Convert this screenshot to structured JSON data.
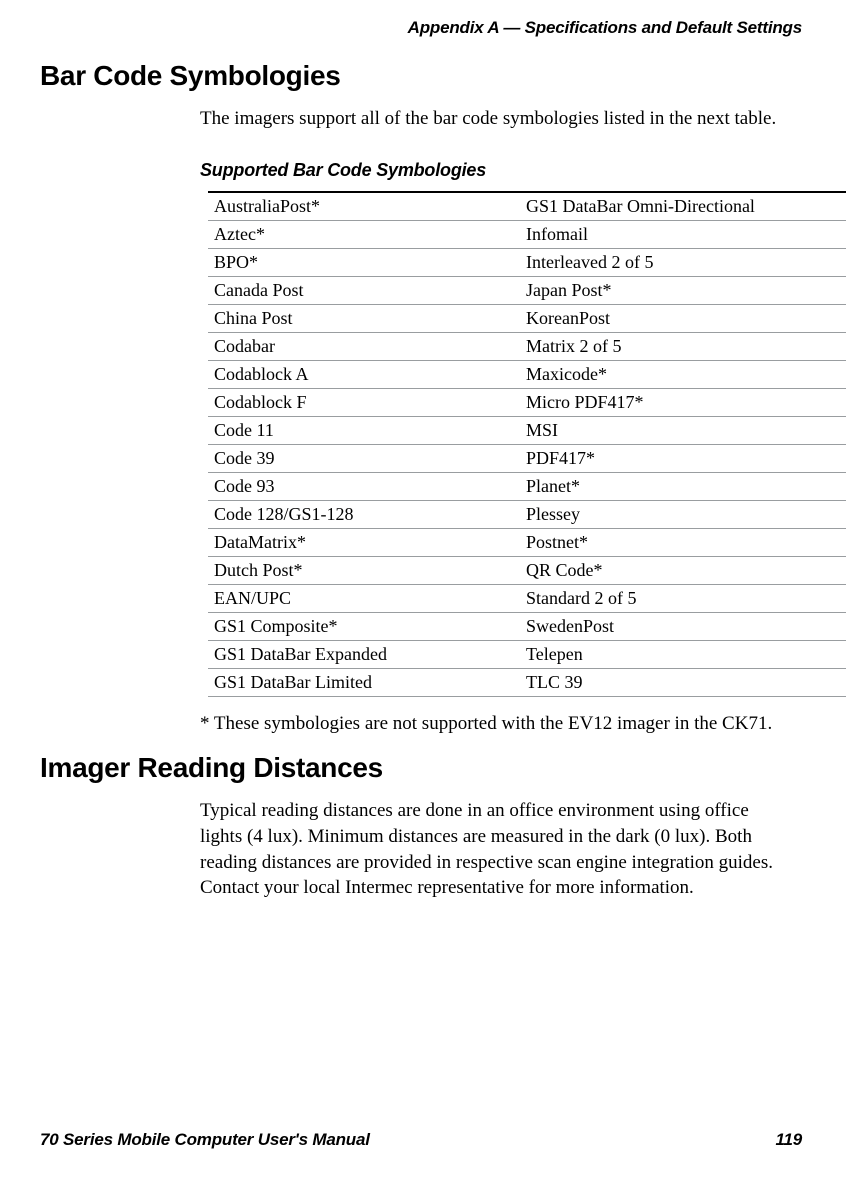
{
  "running_header": "Appendix A — Specifications and Default Settings",
  "section1_heading": "Bar Code Symbologies",
  "section1_intro": "The imagers support all of the bar code symbologies listed in the next table.",
  "table_title": "Supported Bar Code Symbologies",
  "symbologies": {
    "rows": [
      {
        "left": "AustraliaPost*",
        "right": "GS1 DataBar Omni-Directional"
      },
      {
        "left": "Aztec*",
        "right": "Infomail"
      },
      {
        "left": "BPO*",
        "right": "Interleaved 2 of 5"
      },
      {
        "left": "Canada Post",
        "right": "Japan Post*"
      },
      {
        "left": "China Post",
        "right": "KoreanPost"
      },
      {
        "left": "Codabar",
        "right": "Matrix 2 of 5"
      },
      {
        "left": "Codablock A",
        "right": "Maxicode*"
      },
      {
        "left": "Codablock F",
        "right": "Micro PDF417*"
      },
      {
        "left": "Code 11",
        "right": "MSI"
      },
      {
        "left": "Code 39",
        "right": "PDF417*"
      },
      {
        "left": "Code 93",
        "right": "Planet*"
      },
      {
        "left": "Code 128/GS1-128",
        "right": "Plessey"
      },
      {
        "left": "DataMatrix*",
        "right": "Postnet*"
      },
      {
        "left": "Dutch Post*",
        "right": "QR Code*"
      },
      {
        "left": "EAN/UPC",
        "right": "Standard 2 of 5"
      },
      {
        "left": "GS1 Composite*",
        "right": "SwedenPost"
      },
      {
        "left": "GS1 DataBar Expanded",
        "right": "Telepen"
      },
      {
        "left": "GS1 DataBar Limited",
        "right": "TLC 39"
      }
    ]
  },
  "footnote": "* These symbologies are not supported with the EV12 imager in the CK71.",
  "section2_heading": "Imager Reading Distances",
  "section2_para": "Typical reading distances are done in an office environment using office lights (4 lux). Minimum distances are measured in the dark (0 lux). Both reading distances are provided in respective scan engine integration guides. Contact your local Intermec representative for more information.",
  "footer_left": "70 Series Mobile Computer User's Manual",
  "footer_right": "119"
}
